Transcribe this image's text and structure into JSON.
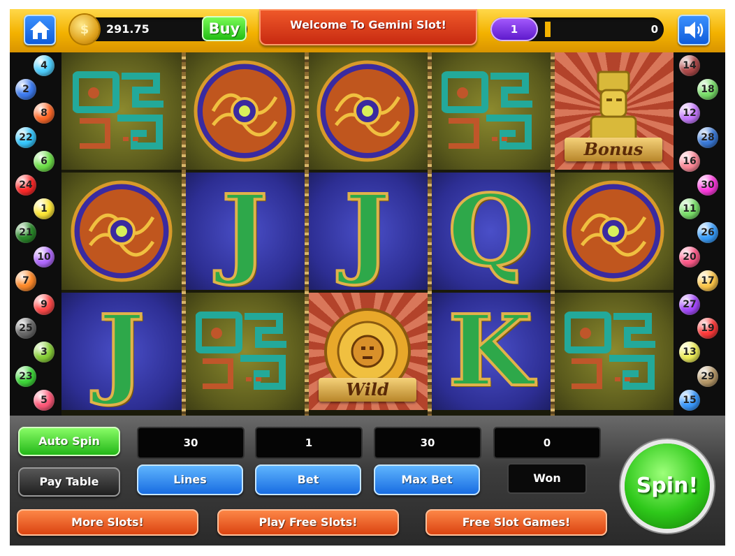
{
  "topbar": {
    "coins": "291.75",
    "buy_label": "Buy",
    "welcome": "Welcome To Gemini Slot!",
    "level": "1",
    "xp": "0",
    "level_progress": 0.03
  },
  "lines_left": [
    "4",
    "2",
    "8",
    "22",
    "6",
    "24",
    "1",
    "21",
    "10",
    "7",
    "9",
    "25",
    "3",
    "23",
    "5"
  ],
  "lines_right": [
    "14",
    "18",
    "12",
    "28",
    "16",
    "30",
    "11",
    "26",
    "20",
    "17",
    "27",
    "19",
    "13",
    "29",
    "15"
  ],
  "reels": [
    [
      {
        "symbol": "glyph",
        "bg": "olive"
      },
      {
        "symbol": "disc",
        "bg": "olive"
      },
      {
        "symbol": "J",
        "bg": "blue"
      }
    ],
    [
      {
        "symbol": "disc",
        "bg": "olive"
      },
      {
        "symbol": "J",
        "bg": "blue"
      },
      {
        "symbol": "glyph",
        "bg": "olive"
      }
    ],
    [
      {
        "symbol": "disc",
        "bg": "olive"
      },
      {
        "symbol": "J",
        "bg": "blue"
      },
      {
        "symbol": "wild",
        "bg": "sun",
        "label": "Wild"
      }
    ],
    [
      {
        "symbol": "glyph",
        "bg": "olive"
      },
      {
        "symbol": "Q",
        "bg": "blue"
      },
      {
        "symbol": "K",
        "bg": "blue"
      }
    ],
    [
      {
        "symbol": "bonus",
        "bg": "sun",
        "label": "Bonus"
      },
      {
        "symbol": "disc",
        "bg": "olive"
      },
      {
        "symbol": "glyph",
        "bg": "olive"
      }
    ]
  ],
  "controls": {
    "auto_spin": "Auto Spin",
    "pay_table": "Pay Table",
    "lines_value": "30",
    "bet_value": "1",
    "maxbet_value": "30",
    "won_value": "0",
    "lines_label": "Lines",
    "bet_label": "Bet",
    "maxbet_label": "Max Bet",
    "won_label": "Won",
    "more_slots": "More Slots!",
    "play_free": "Play Free Slots!",
    "free_games": "Free Slot Games!",
    "spin": "Spin!"
  },
  "colors": {
    "accent_gold": "#f3b200",
    "reel_olive": "#5a5a1c",
    "reel_blue": "#2d2e93",
    "spin_green": "#2ec81a",
    "button_blue": "#1569e0",
    "button_orange": "#d9400e"
  },
  "icons": {
    "home": "home-icon",
    "sound": "speaker-icon",
    "coin": "coin-icon"
  }
}
